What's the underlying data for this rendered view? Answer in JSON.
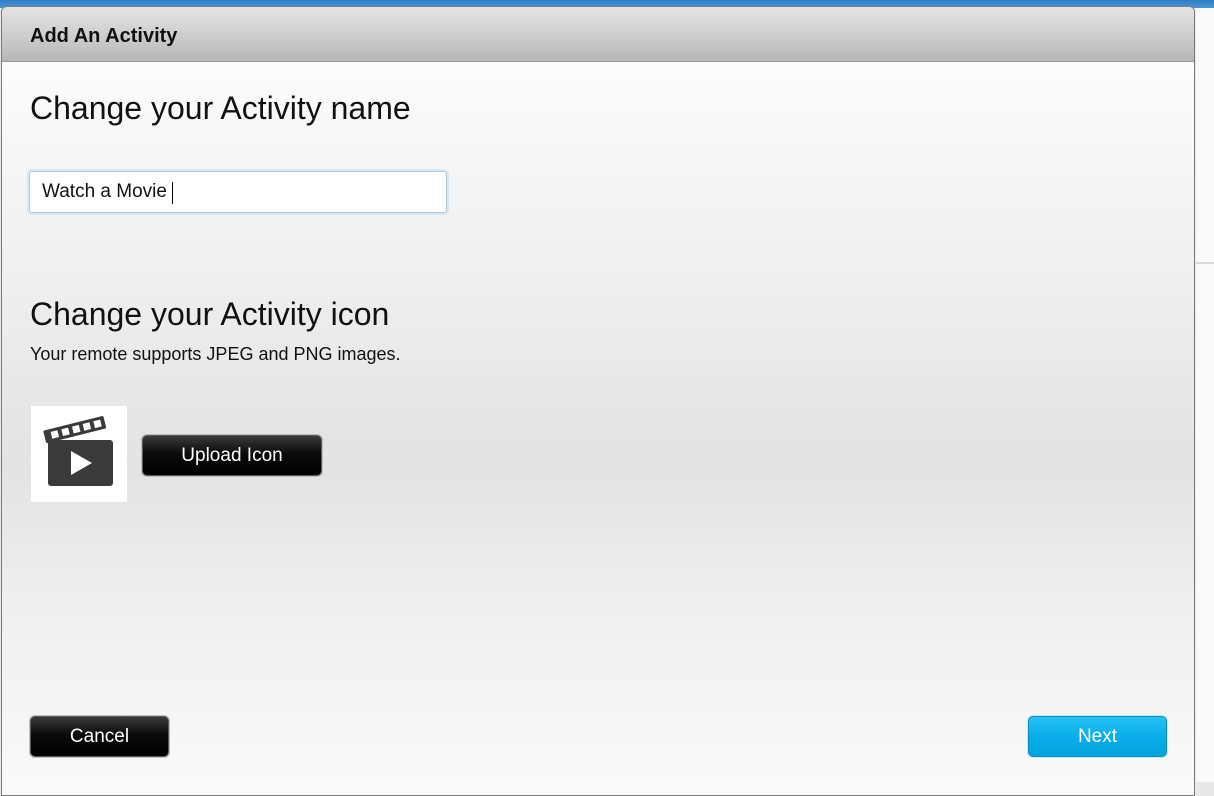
{
  "dialog": {
    "title": "Add An Activity"
  },
  "name_section": {
    "heading": "Change your Activity name",
    "input_value": "Watch a Movie"
  },
  "icon_section": {
    "heading": "Change your Activity icon",
    "note": "Your remote supports JPEG and PNG images.",
    "preview_icon": "movie-clapperboard-play-icon",
    "upload_label": "Upload Icon"
  },
  "footer": {
    "cancel_label": "Cancel",
    "next_label": "Next"
  },
  "colors": {
    "next_accent": "#08aeea",
    "dark_button": "#000000",
    "header_gray": "#cdcdcd",
    "background_topbar": "#2f7fc4"
  }
}
